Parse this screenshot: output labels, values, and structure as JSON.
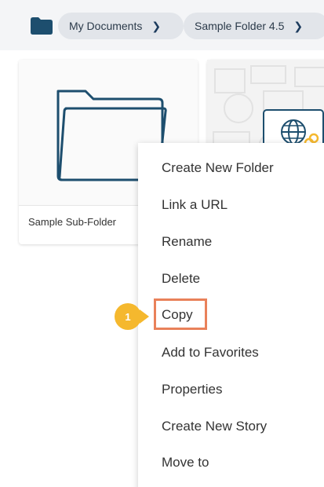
{
  "breadcrumb": {
    "items": [
      {
        "label": "My Documents"
      },
      {
        "label": "Sample Folder 4.5"
      }
    ],
    "separator_icon": "chevron-right-icon"
  },
  "cards": [
    {
      "name": "Sample Sub-Folder",
      "icon": "folder-outline-icon"
    },
    {
      "name": "",
      "icon": "globe-link-icon"
    }
  ],
  "context_menu": {
    "items": [
      {
        "label": "Create New Folder"
      },
      {
        "label": "Link a URL"
      },
      {
        "label": "Rename"
      },
      {
        "label": "Delete"
      },
      {
        "label": "Copy"
      },
      {
        "label": "Add to Favorites"
      },
      {
        "label": "Properties"
      },
      {
        "label": "Create New Story"
      },
      {
        "label": "Move to"
      }
    ],
    "highlighted_item": "Copy"
  },
  "step_badge": {
    "number": "1"
  },
  "colors": {
    "accent_dark_blue": "#1d4e6e",
    "highlight_border": "#e9815a",
    "step_badge": "#f5b82e"
  }
}
